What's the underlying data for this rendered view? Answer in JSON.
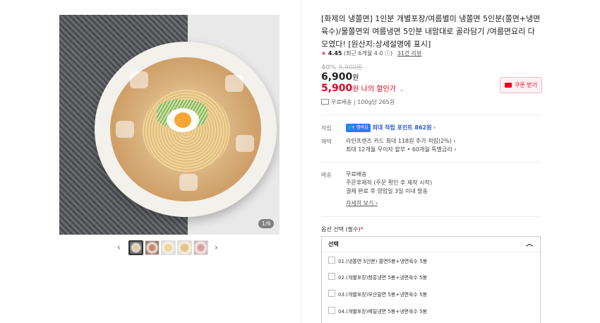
{
  "gallery": {
    "counter": "1/6",
    "prev_arrow": "‹",
    "next_arrow": "›"
  },
  "product": {
    "title": "[화제의 냉쫄면] 1인분 개별포장/여름별미 냉쫄면 5인분(쫄면+냉면육수)/물쫄면외 여름냉면 5인분 내맘대로 골라담기 /여름면요리 다 모였다! [원산지:상세설명에 표시]",
    "rating_star": "★",
    "rating_score": "4.45",
    "rating_note": "(최근 6개월 4.0 ⓘ)",
    "review_link": "31건 리뷰",
    "discount_pct": "40%",
    "original_price": "9,900원",
    "price": "6,900",
    "price_unit": "원",
    "sale_price": "5,900",
    "sale_unit": "원",
    "sale_label": " 나의 할인가",
    "sale_chevron": "⌄",
    "coupon_label": "쿠폰 받기",
    "shipping_info": "무료배송 | 100g당 265원"
  },
  "benefits": {
    "points_label": "적립",
    "points_badge_n": "N",
    "points_badge_text": "+ 멤버십",
    "points_text": "최대 적립 포인트 ",
    "points_value": "862원",
    "points_chevron": " ›",
    "card_label": "혜택",
    "card_line1": "라인프렌즈 카드 최대 118원 추가 적립(2%) ›",
    "card_line2": "최대 12개월 무이자 할부 • 60개월 특별금리 ›"
  },
  "delivery": {
    "label": "배송",
    "line1": "무료배송",
    "line2": "주문후제작 (주문 확인 후 제작 시작)",
    "line3": "결제 완료 후 영업일 3일 이내 발송",
    "more_link": "자세히 보기 ›"
  },
  "options": {
    "label": "옵션 선택 (필수)",
    "required_mark": "*",
    "select_placeholder": "선택",
    "caret": "︿",
    "items": [
      "01.(냉쫄면 5인분) 쫄면5봉+냉면육수 5봉",
      "02.(개별포장)함흥냉면 5봉+냉면육수 5봉",
      "03.(개별포장)부산밀면 5봉+냉면육수 5봉",
      "04.(개별포장)메밀냉면 5봉+냉면육수 5봉"
    ]
  }
}
